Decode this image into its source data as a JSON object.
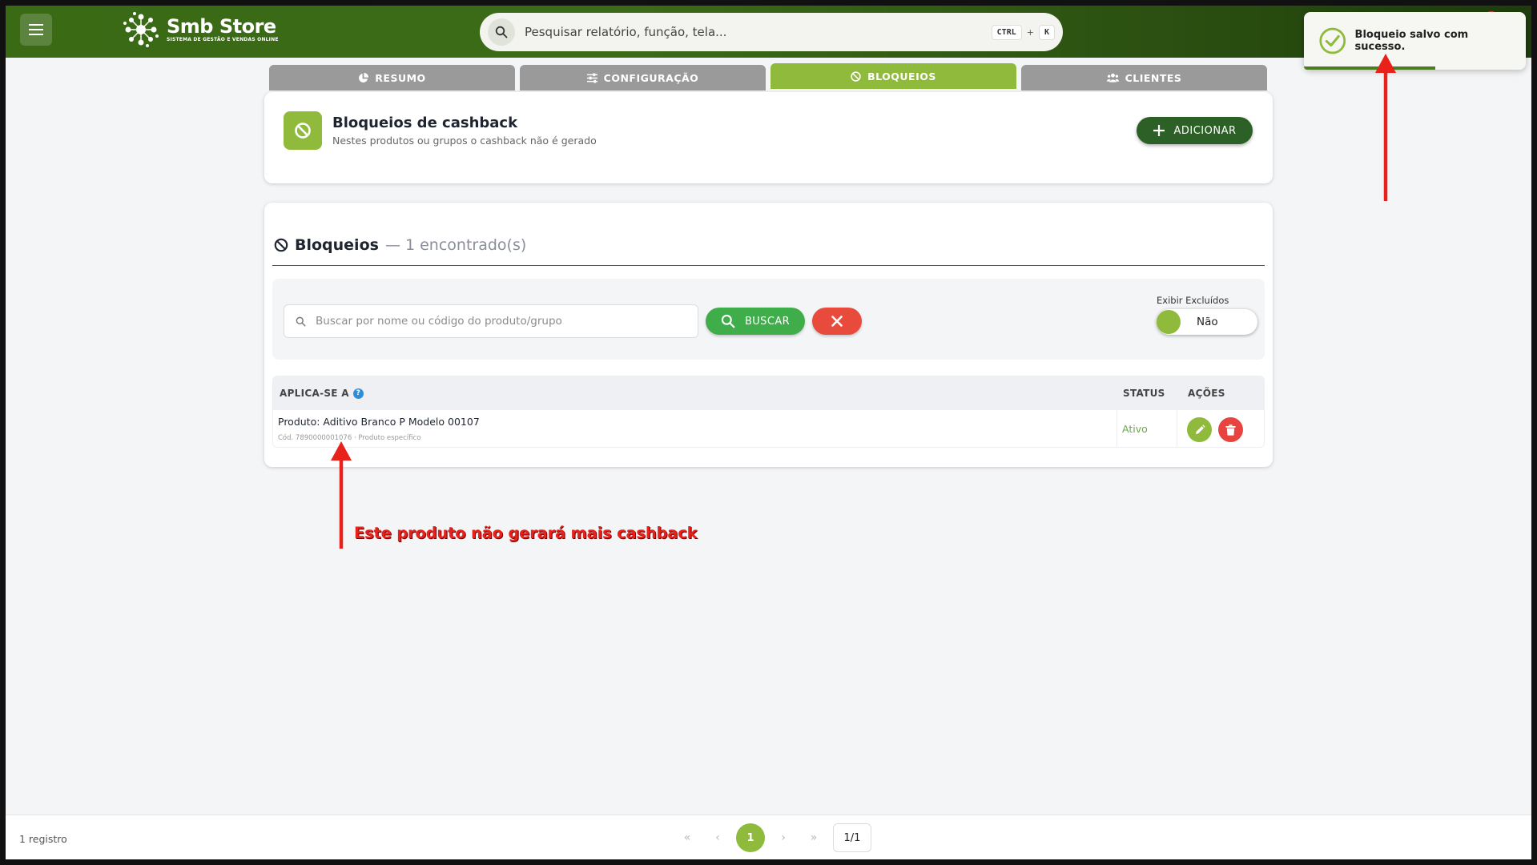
{
  "app": {
    "name": "Smb Store",
    "tagline": "SISTEMA DE GESTÃO E VENDAS ONLINE"
  },
  "global_search": {
    "placeholder": "Pesquisar relatório, função, tela...",
    "shortcut_key1": "CTRL",
    "shortcut_plus": "+",
    "shortcut_key2": "K"
  },
  "toast": {
    "message": "Bloqueio salvo com sucesso."
  },
  "tabs": [
    {
      "label": "RESUMO",
      "icon": "pie-chart-icon",
      "active": false
    },
    {
      "label": "CONFIGURAÇÃO",
      "icon": "sliders-icon",
      "active": false
    },
    {
      "label": "BLOQUEIOS",
      "icon": "ban-icon",
      "active": true
    },
    {
      "label": "CLIENTES",
      "icon": "users-icon",
      "active": false
    }
  ],
  "header_card": {
    "title": "Bloqueios de cashback",
    "subtitle": "Nestes produtos ou grupos o cashback não é gerado",
    "add_label": "ADICIONAR"
  },
  "list": {
    "title": "Bloqueios",
    "count_text": "— 1 encontrado(s)",
    "search_placeholder": "Buscar por nome ou código do produto/grupo",
    "search_button": "BUSCAR",
    "show_deleted_label": "Exibir Excluídos",
    "show_deleted_value": "Não",
    "columns": {
      "apply": "APLICA-SE A",
      "status": "STATUS",
      "actions": "AÇÕES"
    },
    "rows": [
      {
        "name": "Produto: Aditivo Branco P Modelo 00107",
        "meta": "Cód. 7890000001076 · Produto específico",
        "status": "Ativo"
      }
    ]
  },
  "annotation": {
    "text": "Este produto não gerará mais cashback"
  },
  "footer": {
    "count": "1 registro",
    "current_page": "1",
    "page_total": "1/1"
  },
  "colors": {
    "brand_green": "#3c6b18",
    "accent_green": "#8fba3b",
    "dark_green_button": "#2d6026",
    "buscar_green": "#3fae4a",
    "danger_red": "#e84a3c",
    "annotation_red": "#e8211b"
  }
}
